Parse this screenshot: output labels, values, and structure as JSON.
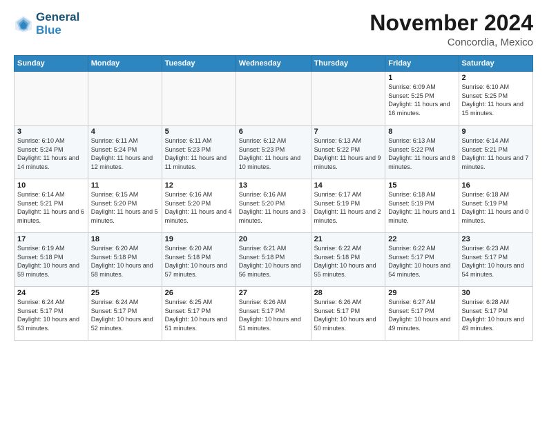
{
  "logo": {
    "line1": "General",
    "line2": "Blue"
  },
  "title": "November 2024",
  "subtitle": "Concordia, Mexico",
  "days_header": [
    "Sunday",
    "Monday",
    "Tuesday",
    "Wednesday",
    "Thursday",
    "Friday",
    "Saturday"
  ],
  "weeks": [
    [
      {
        "day": "",
        "info": ""
      },
      {
        "day": "",
        "info": ""
      },
      {
        "day": "",
        "info": ""
      },
      {
        "day": "",
        "info": ""
      },
      {
        "day": "",
        "info": ""
      },
      {
        "day": "1",
        "info": "Sunrise: 6:09 AM\nSunset: 5:25 PM\nDaylight: 11 hours and 16 minutes."
      },
      {
        "day": "2",
        "info": "Sunrise: 6:10 AM\nSunset: 5:25 PM\nDaylight: 11 hours and 15 minutes."
      }
    ],
    [
      {
        "day": "3",
        "info": "Sunrise: 6:10 AM\nSunset: 5:24 PM\nDaylight: 11 hours and 14 minutes."
      },
      {
        "day": "4",
        "info": "Sunrise: 6:11 AM\nSunset: 5:24 PM\nDaylight: 11 hours and 12 minutes."
      },
      {
        "day": "5",
        "info": "Sunrise: 6:11 AM\nSunset: 5:23 PM\nDaylight: 11 hours and 11 minutes."
      },
      {
        "day": "6",
        "info": "Sunrise: 6:12 AM\nSunset: 5:23 PM\nDaylight: 11 hours and 10 minutes."
      },
      {
        "day": "7",
        "info": "Sunrise: 6:13 AM\nSunset: 5:22 PM\nDaylight: 11 hours and 9 minutes."
      },
      {
        "day": "8",
        "info": "Sunrise: 6:13 AM\nSunset: 5:22 PM\nDaylight: 11 hours and 8 minutes."
      },
      {
        "day": "9",
        "info": "Sunrise: 6:14 AM\nSunset: 5:21 PM\nDaylight: 11 hours and 7 minutes."
      }
    ],
    [
      {
        "day": "10",
        "info": "Sunrise: 6:14 AM\nSunset: 5:21 PM\nDaylight: 11 hours and 6 minutes."
      },
      {
        "day": "11",
        "info": "Sunrise: 6:15 AM\nSunset: 5:20 PM\nDaylight: 11 hours and 5 minutes."
      },
      {
        "day": "12",
        "info": "Sunrise: 6:16 AM\nSunset: 5:20 PM\nDaylight: 11 hours and 4 minutes."
      },
      {
        "day": "13",
        "info": "Sunrise: 6:16 AM\nSunset: 5:20 PM\nDaylight: 11 hours and 3 minutes."
      },
      {
        "day": "14",
        "info": "Sunrise: 6:17 AM\nSunset: 5:19 PM\nDaylight: 11 hours and 2 minutes."
      },
      {
        "day": "15",
        "info": "Sunrise: 6:18 AM\nSunset: 5:19 PM\nDaylight: 11 hours and 1 minute."
      },
      {
        "day": "16",
        "info": "Sunrise: 6:18 AM\nSunset: 5:19 PM\nDaylight: 11 hours and 0 minutes."
      }
    ],
    [
      {
        "day": "17",
        "info": "Sunrise: 6:19 AM\nSunset: 5:18 PM\nDaylight: 10 hours and 59 minutes."
      },
      {
        "day": "18",
        "info": "Sunrise: 6:20 AM\nSunset: 5:18 PM\nDaylight: 10 hours and 58 minutes."
      },
      {
        "day": "19",
        "info": "Sunrise: 6:20 AM\nSunset: 5:18 PM\nDaylight: 10 hours and 57 minutes."
      },
      {
        "day": "20",
        "info": "Sunrise: 6:21 AM\nSunset: 5:18 PM\nDaylight: 10 hours and 56 minutes."
      },
      {
        "day": "21",
        "info": "Sunrise: 6:22 AM\nSunset: 5:18 PM\nDaylight: 10 hours and 55 minutes."
      },
      {
        "day": "22",
        "info": "Sunrise: 6:22 AM\nSunset: 5:17 PM\nDaylight: 10 hours and 54 minutes."
      },
      {
        "day": "23",
        "info": "Sunrise: 6:23 AM\nSunset: 5:17 PM\nDaylight: 10 hours and 54 minutes."
      }
    ],
    [
      {
        "day": "24",
        "info": "Sunrise: 6:24 AM\nSunset: 5:17 PM\nDaylight: 10 hours and 53 minutes."
      },
      {
        "day": "25",
        "info": "Sunrise: 6:24 AM\nSunset: 5:17 PM\nDaylight: 10 hours and 52 minutes."
      },
      {
        "day": "26",
        "info": "Sunrise: 6:25 AM\nSunset: 5:17 PM\nDaylight: 10 hours and 51 minutes."
      },
      {
        "day": "27",
        "info": "Sunrise: 6:26 AM\nSunset: 5:17 PM\nDaylight: 10 hours and 51 minutes."
      },
      {
        "day": "28",
        "info": "Sunrise: 6:26 AM\nSunset: 5:17 PM\nDaylight: 10 hours and 50 minutes."
      },
      {
        "day": "29",
        "info": "Sunrise: 6:27 AM\nSunset: 5:17 PM\nDaylight: 10 hours and 49 minutes."
      },
      {
        "day": "30",
        "info": "Sunrise: 6:28 AM\nSunset: 5:17 PM\nDaylight: 10 hours and 49 minutes."
      }
    ]
  ]
}
